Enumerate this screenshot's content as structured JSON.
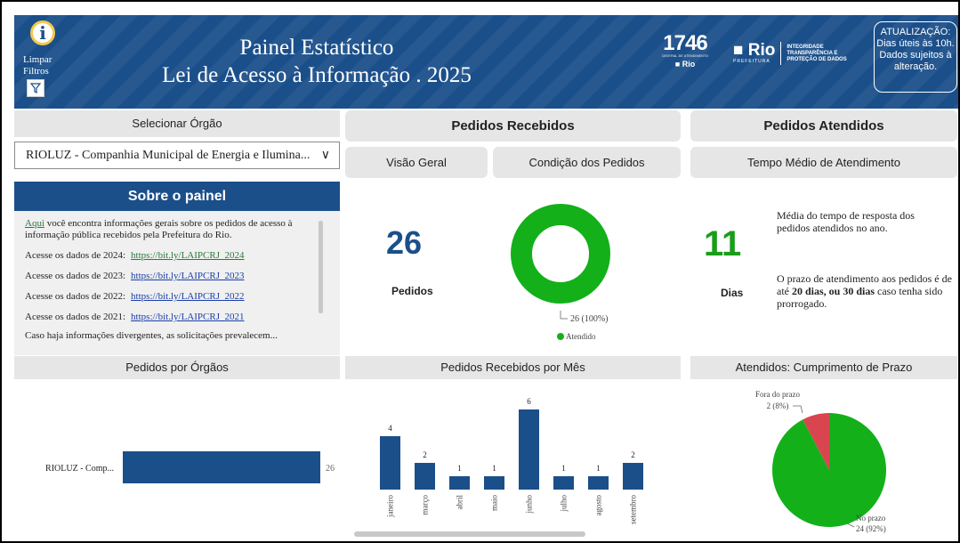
{
  "header": {
    "clear_filters_label": "Limpar Filtros",
    "title_line1": "Painel Estatístico",
    "title_line2": "Lei de Acesso à Informação . 2025",
    "logo1746_number": "1746",
    "logo1746_sub": "CENTRAL DE ATENDIMENTO",
    "logo1746_rio": "Rio",
    "rio_logo_text": "Rio",
    "rio_logo_sub": "PREFEITURA",
    "integridade_text": "INTEGRIDADE TRANSPARÊNCIA E PROTEÇÃO DE DADOS",
    "update_box": "ATUALIZAÇÃO: Dias úteis às 10h. Dados sujeitos à alteração."
  },
  "selector": {
    "label": "Selecionar Órgão",
    "selected_value": "RIOLUZ - Companhia Municipal de Energia e Ilumina..."
  },
  "sobre": {
    "title": "Sobre o painel",
    "intro_link": "Aqui",
    "intro_text": " você encontra informações gerais sobre os pedidos de acesso à informação pública recebidos pela Prefeitura do Rio.",
    "rows": [
      {
        "label": "Acesse os dados de 2024:",
        "link": "https://bit.ly/LAIPCRJ_2024"
      },
      {
        "label": "Acesse os dados de 2023:",
        "link": "https://bit.ly/LAIPCRJ_2023"
      },
      {
        "label": "Acesse os dados de 2022:",
        "link": "https://bit.ly/LAIPCRJ_2022"
      },
      {
        "label": "Acesse os dados de 2021:",
        "link": "https://bit.ly/LAIPCRJ_2021"
      }
    ],
    "cut_text": "Caso haja informações divergentes, as solicitações prevalecem..."
  },
  "recebidos": {
    "title": "Pedidos Recebidos",
    "tab_overview": "Visão Geral",
    "tab_condicao": "Condição dos Pedidos",
    "total": "26",
    "total_label": "Pedidos",
    "donut_label": "26 (100%)",
    "legend": "Atendido",
    "color_atendido": "#13b01a"
  },
  "atendidos": {
    "title": "Pedidos Atendidos",
    "tab_tempo": "Tempo Médio de Atendimento",
    "days": "11",
    "days_label": "Dias",
    "desc1": "Média do tempo de resposta dos pedidos atendidos no ano.",
    "desc2_a": "O prazo de atendimento aos pedidos é de até ",
    "desc2_b": "20 dias, ou 30 dias",
    "desc2_c": " caso tenha sido prorrogado."
  },
  "orgaos": {
    "title": "Pedidos por Órgãos"
  },
  "mes": {
    "title": "Pedidos Recebidos por Mês"
  },
  "prazo": {
    "title": "Atendidos: Cumprimento de Prazo"
  },
  "chart_data": [
    {
      "type": "bar",
      "orientation": "horizontal",
      "categories": [
        "RIOLUZ - Comp..."
      ],
      "values": [
        26
      ],
      "data_labels": [
        "26"
      ],
      "color": "#1b4f8a"
    },
    {
      "type": "bar",
      "categories": [
        "janeiro",
        "março",
        "abril",
        "maio",
        "junho",
        "julho",
        "agosto",
        "setembro"
      ],
      "values": [
        4,
        2,
        1,
        1,
        6,
        1,
        1,
        2
      ],
      "color": "#1b4f8a"
    },
    {
      "type": "pie",
      "categories": [
        "No prazo",
        "Fora do prazo"
      ],
      "values": [
        24,
        2
      ],
      "labels": [
        "24 (92%)",
        "2 (8%)"
      ],
      "colors": [
        "#13b01a",
        "#d9454f"
      ]
    },
    {
      "type": "pie",
      "categories": [
        "Atendido"
      ],
      "values": [
        26
      ],
      "labels": [
        "26 (100%)"
      ],
      "colors": [
        "#13b01a"
      ]
    }
  ]
}
